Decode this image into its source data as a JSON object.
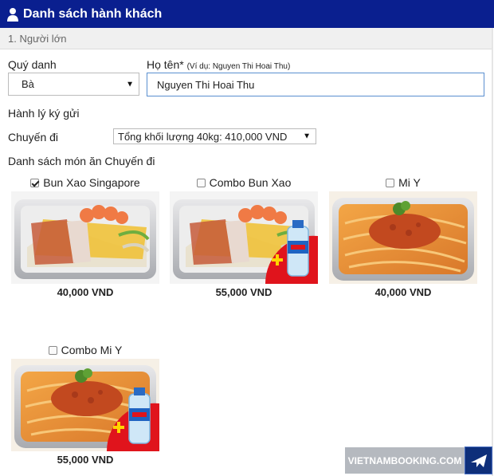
{
  "header": {
    "title": "Danh sách hành khách",
    "icon": "user-icon",
    "background": "#0a1f8f"
  },
  "section": {
    "label": "1. Người lớn"
  },
  "form": {
    "salutation_label": "Quý danh",
    "salutation_value": "Bà",
    "fullname_label": "Họ tên*",
    "fullname_hint": "(Ví dụ: Nguyen Thi Hoai Thu)",
    "fullname_value": "Nguyen Thi Hoai Thu",
    "baggage_label": "Hành lý ký gửi",
    "trip_label": "Chuyến đi",
    "baggage_value": "Tổng khối lượng 40kg: 410,000 VND",
    "meals_label": "Danh sách món ăn Chuyến đi"
  },
  "meals": [
    {
      "name": "Bun Xao Singapore",
      "price": "40,000 VND",
      "checked": true,
      "image": "noodle-seafood"
    },
    {
      "name": "Combo Bun Xao",
      "price": "55,000 VND",
      "checked": false,
      "image": "noodle-seafood-water"
    },
    {
      "name": "Mi Y",
      "price": "40,000 VND",
      "checked": false,
      "image": "spaghetti"
    },
    {
      "name": "Combo Mi Y",
      "price": "55,000 VND",
      "checked": false,
      "image": "spaghetti-water"
    }
  ],
  "watermark": {
    "text": "VIETNAMBOOKING.COM",
    "icon": "airplane-icon"
  }
}
